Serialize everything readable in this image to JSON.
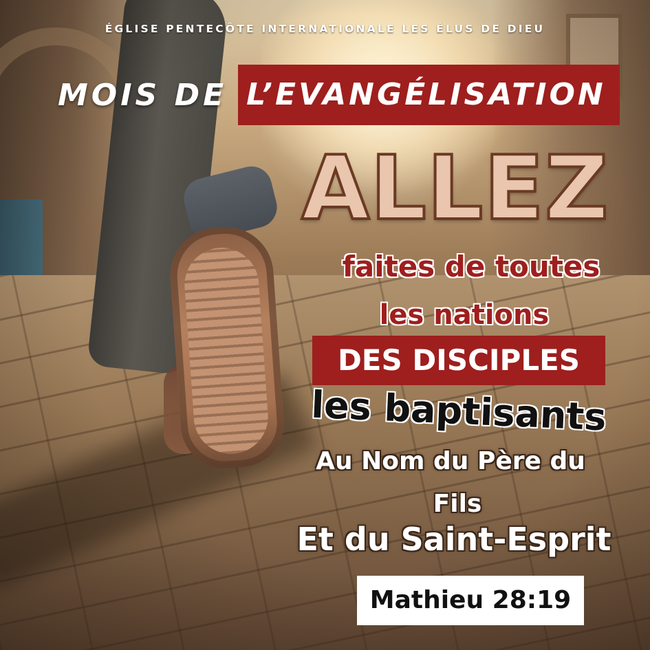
{
  "header": {
    "church_name": "ÉGLISE PENTECÔTE INTERNATIONALE LES ÉLUS DE DIEU"
  },
  "title": {
    "plain": "MOIS DE",
    "highlighted": "L’EVANGÉLISATION"
  },
  "verse": {
    "headline": "ALLEZ",
    "line1": "faites de toutes",
    "line2": "les nations",
    "line3": "DES DISCIPLES",
    "line4": "les baptisants",
    "line5": "Au Nom du Père du",
    "line6": "Fils",
    "line7": "Et du Saint-Esprit",
    "reference": "Mathieu 28:19"
  },
  "colors": {
    "accent_red": "#9e1f1d",
    "headline_fill": "#e9c6ad",
    "headline_outline": "#6b3a24",
    "text_white": "#ffffff",
    "text_dark": "#111111"
  }
}
